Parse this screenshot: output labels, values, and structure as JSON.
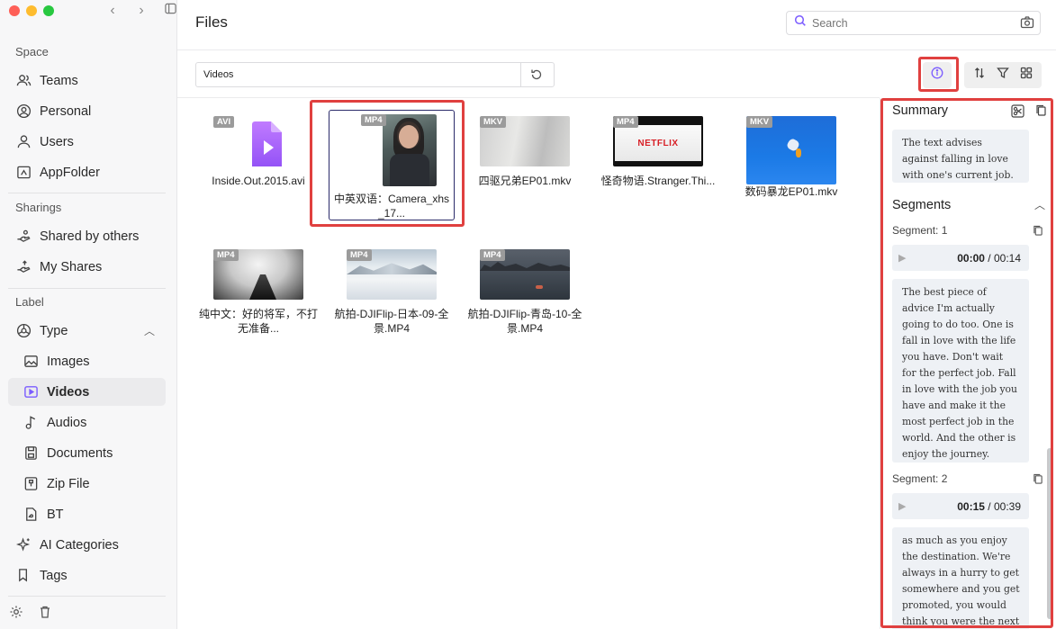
{
  "sidebar": {
    "space_label": "Space",
    "space_items": [
      {
        "label": "Teams",
        "icon": "users-icon"
      },
      {
        "label": "Personal",
        "icon": "person-circle-icon"
      },
      {
        "label": "Users",
        "icon": "user-icon"
      },
      {
        "label": "AppFolder",
        "icon": "app-folder-icon"
      }
    ],
    "sharings_label": "Sharings",
    "sharing_items": [
      {
        "label": "Shared by others",
        "icon": "shared-hand-icon"
      },
      {
        "label": "My Shares",
        "icon": "share-hand-icon"
      }
    ],
    "label_label": "Label",
    "type_label": "Type",
    "type_items": [
      {
        "label": "Images",
        "icon": "image-icon"
      },
      {
        "label": "Videos",
        "icon": "video-icon",
        "active": true
      },
      {
        "label": "Audios",
        "icon": "music-note-icon"
      },
      {
        "label": "Documents",
        "icon": "document-icon"
      },
      {
        "label": "Zip File",
        "icon": "zip-icon"
      },
      {
        "label": "BT",
        "icon": "bt-file-icon"
      }
    ],
    "ai_categories_label": "AI Categories",
    "tags_label": "Tags"
  },
  "header": {
    "title": "Files",
    "search_placeholder": "Search"
  },
  "toolbar": {
    "path_value": "Videos"
  },
  "files": [
    {
      "badge": "AVI",
      "name": "Inside.Out.2015.avi"
    },
    {
      "badge": "MP4",
      "name": "中英双语：Camera_xhs_17...",
      "selected": true
    },
    {
      "badge": "MKV",
      "name": "四驱兄弟EP01.mkv"
    },
    {
      "badge": "MP4",
      "name": "怪奇物语.Stranger.Thi..."
    },
    {
      "badge": "MKV",
      "name": "数码暴龙EP01.mkv"
    },
    {
      "badge": "MP4",
      "name": "纯中文：好的将军，不打无准备..."
    },
    {
      "badge": "MP4",
      "name": "航拍-DJIFlip-日本-09-全景.MP4"
    },
    {
      "badge": "MP4",
      "name": "航拍-DJIFlip-青岛-10-全景.MP4"
    }
  ],
  "netflix_logo_text": "NETFLIX",
  "panel": {
    "summary_title": "Summary",
    "summary_text": "The text advises against falling in love with one's current job.",
    "segments_title": "Segments",
    "segments": [
      {
        "label": "Segment: 1",
        "current": "00:00",
        "end": "/ 00:14",
        "text": "The best piece of advice I'm actually going to do too. One is fall in love with the life you have. Don't wait for the perfect job. Fall in love with the job you have and make it the most perfect job in the world. And the other is enjoy the journey."
      },
      {
        "label": "Segment: 2",
        "current": "00:15",
        "end": "/ 00:39",
        "text": "as much as you enjoy the destination. We're always in a hurry to get somewhere and you get promoted, you would think you were the next"
      }
    ]
  },
  "colors": {
    "accent": "#7b5cff",
    "highlight": "#e0403f",
    "video_icon": "#a259ff"
  }
}
